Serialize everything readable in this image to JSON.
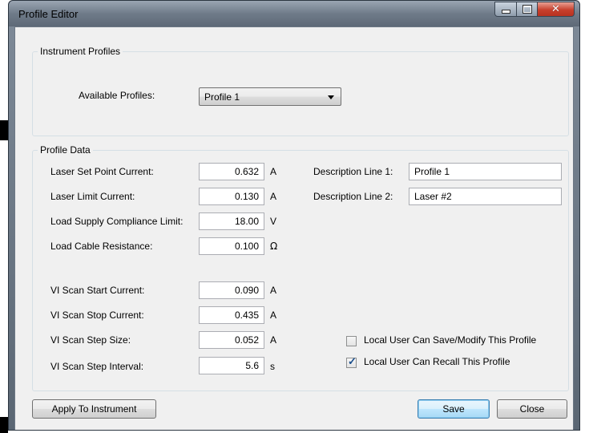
{
  "window": {
    "title": "Profile Editor"
  },
  "instrument_profiles": {
    "group_title": "Instrument Profiles",
    "available_label": "Available Profiles:",
    "selected_profile": "Profile 1"
  },
  "profile_data": {
    "group_title": "Profile Data",
    "rows": [
      {
        "label": "Laser Set Point Current:",
        "value": "0.632",
        "unit": "A"
      },
      {
        "label": "Laser Limit Current:",
        "value": "0.130",
        "unit": "A"
      },
      {
        "label": "Load Supply Compliance Limit:",
        "value": "18.00",
        "unit": "V"
      },
      {
        "label": "Load Cable Resistance:",
        "value": "0.100",
        "unit": "Ω"
      },
      {
        "label": "VI Scan Start Current:",
        "value": "0.090",
        "unit": "A"
      },
      {
        "label": "VI Scan Stop Current:",
        "value": "0.435",
        "unit": "A"
      },
      {
        "label": "VI Scan Step Size:",
        "value": "0.052",
        "unit": "A"
      },
      {
        "label": "VI Scan Step Interval:",
        "value": "5.6",
        "unit": "s"
      }
    ],
    "description": [
      {
        "label": "Description Line 1:",
        "value": "Profile 1"
      },
      {
        "label": "Description Line 2:",
        "value": "Laser #2"
      }
    ],
    "checkboxes": [
      {
        "label": "Local User Can Save/Modify This Profile",
        "checked": false
      },
      {
        "label": "Local User Can Recall This Profile",
        "checked": true
      }
    ]
  },
  "buttons": {
    "apply": "Apply To Instrument",
    "save": "Save",
    "close": "Close"
  }
}
